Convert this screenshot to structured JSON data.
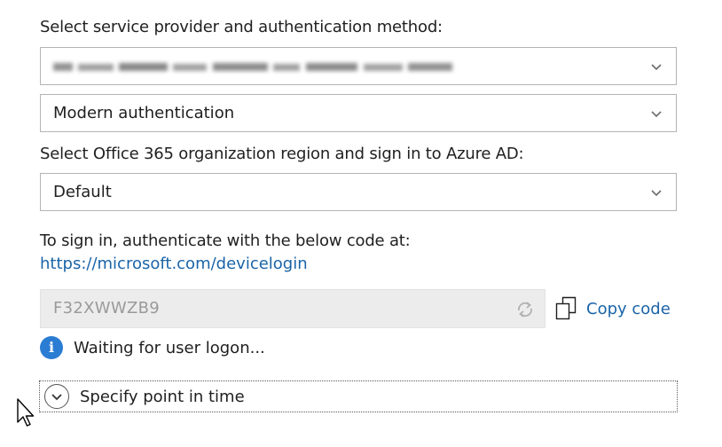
{
  "provider_section": {
    "label": "Select service provider and authentication method:",
    "provider_value": "",
    "auth_method_value": "Modern authentication"
  },
  "region_section": {
    "label": "Select Office 365 organization region and sign in to Azure AD:",
    "region_value": "Default"
  },
  "signin": {
    "instruction": "To sign in, authenticate with the below code at:",
    "url": "https://microsoft.com/devicelogin",
    "code": "F32XWWZB9",
    "copy_label": "Copy code"
  },
  "status": {
    "text": "Waiting for user logon..."
  },
  "expander": {
    "label": "Specify point in time"
  },
  "icons": {
    "dropdown": "chevron-down-icon",
    "refresh": "refresh-icon",
    "copy": "copy-icon",
    "info": "info-icon",
    "expand": "expand-circle-icon",
    "cursor": "mouse-pointer-icon"
  },
  "colors": {
    "link": "#1a64a8",
    "info": "#2b7cd3",
    "disabled_field": "#ececec"
  }
}
